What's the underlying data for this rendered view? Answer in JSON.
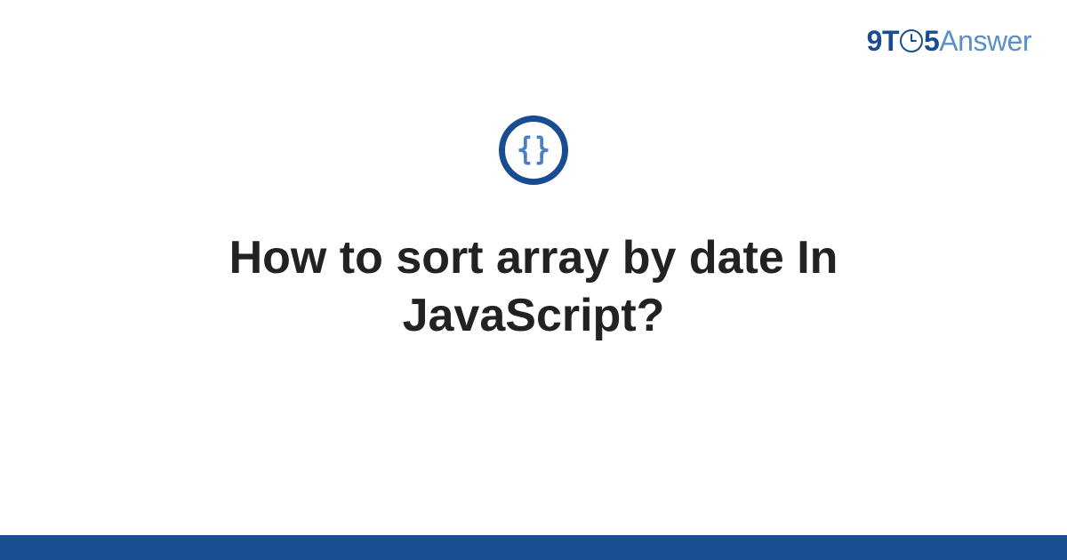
{
  "brand": {
    "part1": "9T",
    "part2": "5",
    "part3": "Answer"
  },
  "topic": {
    "icon_name": "code-braces-icon"
  },
  "article": {
    "title": "How to sort array by date In JavaScript?"
  },
  "colors": {
    "accent_dark": "#1a4d8f",
    "accent_light": "#5b8fc7",
    "brace_color": "#4a7fc4"
  }
}
